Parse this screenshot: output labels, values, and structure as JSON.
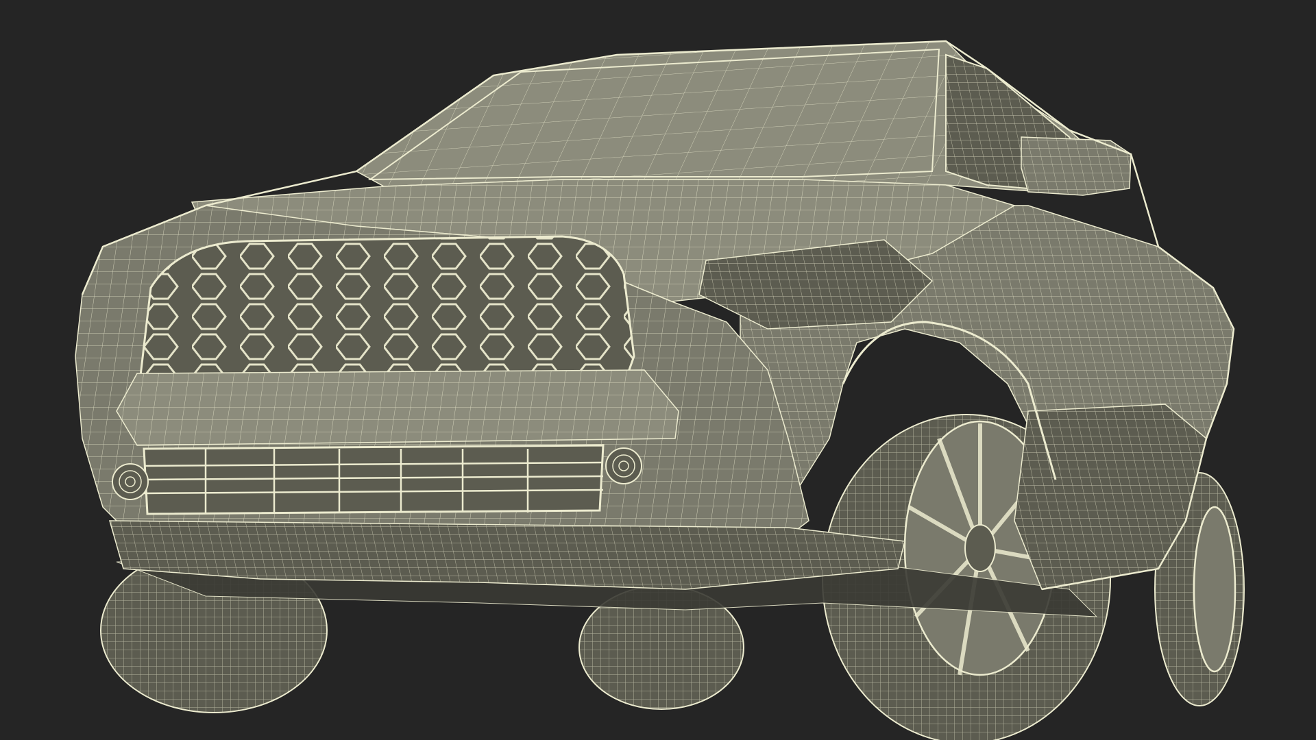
{
  "scene": {
    "subject": "suv-wireframe-render",
    "colors": {
      "background": "#252525",
      "body_fill": "#7a7a6c",
      "body_fill_dark": "#5c5c50",
      "body_fill_light": "#8c8c7c",
      "wire": "#ecebcf",
      "shadow": "#3a3a34"
    },
    "wire_density": "high"
  }
}
